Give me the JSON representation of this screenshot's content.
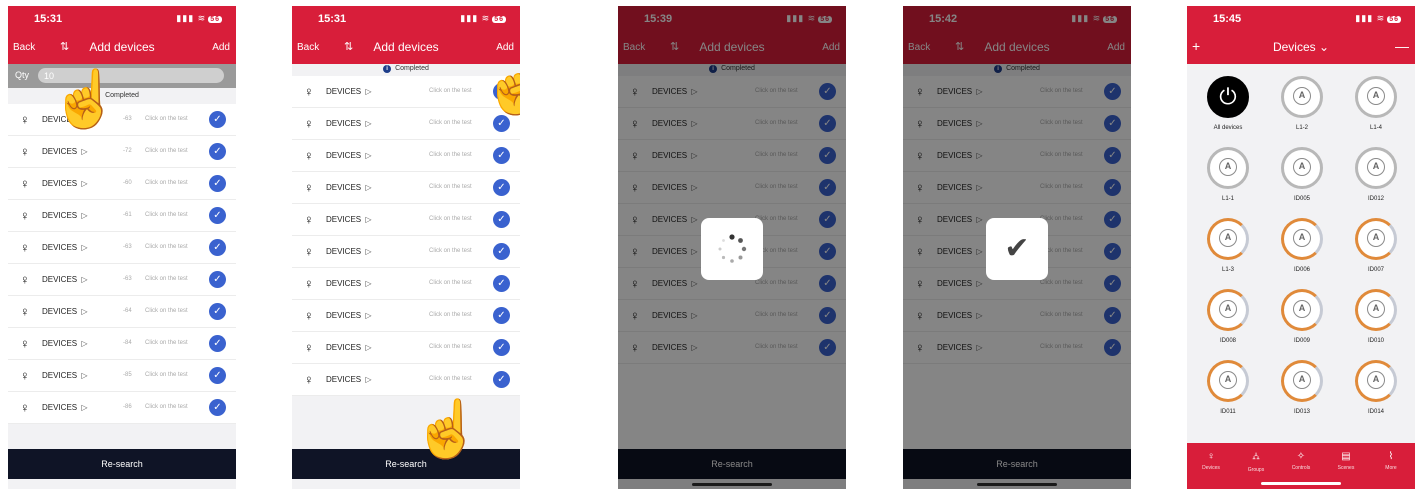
{
  "colors": {
    "brand_red": "#d81e3a",
    "check_blue": "#3a62cf",
    "dark_bar": "#0f1426"
  },
  "screens": [
    {
      "time": "15:31",
      "battery": "56",
      "back": "Back",
      "title": "Add devices",
      "add": "Add",
      "qty_label": "Qty",
      "qty_value": "10",
      "status": "Completed",
      "rows": [
        {
          "name": "DEVICES",
          "rssi": "-63",
          "hint": "Click on the test"
        },
        {
          "name": "DEVICES",
          "rssi": "-72",
          "hint": "Click on the test"
        },
        {
          "name": "DEVICES",
          "rssi": "-60",
          "hint": "Click on the test"
        },
        {
          "name": "DEVICES",
          "rssi": "-61",
          "hint": "Click on the test"
        },
        {
          "name": "DEVICES",
          "rssi": "-63",
          "hint": "Click on the test"
        },
        {
          "name": "DEVICES",
          "rssi": "-63",
          "hint": "Click on the test"
        },
        {
          "name": "DEVICES",
          "rssi": "-64",
          "hint": "Click on the test"
        },
        {
          "name": "DEVICES",
          "rssi": "-84",
          "hint": "Click on the test"
        },
        {
          "name": "DEVICES",
          "rssi": "-85",
          "hint": "Click on the test"
        },
        {
          "name": "DEVICES",
          "rssi": "-86",
          "hint": "Click on the test"
        }
      ],
      "research": "Re-search"
    },
    {
      "time": "15:31",
      "battery": "56",
      "back": "Back",
      "title": "Add devices",
      "add": "Add",
      "status": "Completed",
      "hint": "Click on the test",
      "device": "DEVICES",
      "research": "Re-search"
    },
    {
      "time": "15:39",
      "battery": "56",
      "back": "Back",
      "title": "Add devices",
      "add": "Add",
      "status": "Completed",
      "hint": "Click on the test",
      "device": "DEVICES",
      "research": "Re-search"
    },
    {
      "time": "15:42",
      "battery": "56",
      "back": "Back",
      "title": "Add devices",
      "add": "Add",
      "status": "Completed",
      "hint": "Click on the test",
      "device": "DEVICES",
      "research": "Re-search"
    },
    {
      "time": "15:45",
      "battery": "56",
      "title": "Devices",
      "devices": [
        "All devices",
        "L1-2",
        "L1-4",
        "L1-1",
        "ID005",
        "ID012",
        "L1-3",
        "ID006",
        "ID007",
        "ID008",
        "ID009",
        "ID010",
        "ID011",
        "ID013",
        "ID014"
      ],
      "tabs": [
        "Devices",
        "Groups",
        "Controls",
        "Scenes",
        "More"
      ]
    }
  ]
}
